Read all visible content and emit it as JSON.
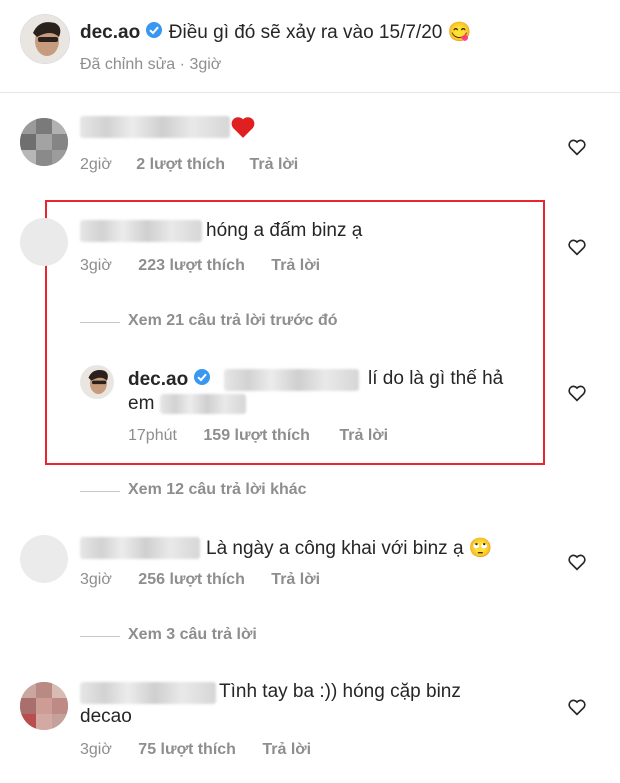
{
  "post": {
    "username": "dec.ao",
    "caption": "Điều gì đó sẽ xảy ra vào 15/7/20",
    "emoji": "😋",
    "edited": "Đã chỉnh sửa",
    "separator": "·",
    "time": "3giờ"
  },
  "comments": [
    {
      "text": "❤️",
      "time": "2giờ",
      "likes": "2 lượt thích",
      "reply": "Trả lời"
    },
    {
      "text": "hóng a đấm binz ạ",
      "time": "3giờ",
      "likes": "223 lượt thích",
      "reply": "Trả lời"
    },
    {
      "text": "Là ngày a công khai với binz ạ",
      "emoji": "🙄",
      "time": "3giờ",
      "likes": "256 lượt thích",
      "reply": "Trả lời"
    },
    {
      "text_line1": "Tình tay ba :)) hóng cặp binz",
      "text_line2": "decao",
      "time": "3giờ",
      "likes": "75 lượt thích",
      "reply": "Trả lời"
    }
  ],
  "reply": {
    "username": "dec.ao",
    "text_line1": "lí do là gì thế hả",
    "text_line2": "em",
    "time": "17phút",
    "likes": "159 lượt thích",
    "reply_label": "Trả lời"
  },
  "view_replies": {
    "previous": "Xem 21 câu trả lời trước đó",
    "other": "Xem 12 câu trả lời khác",
    "three": "Xem 3 câu trả lời"
  },
  "colors": {
    "highlight_border": "#e8262f",
    "verified": "#3897f0",
    "heart_red": "#ed4956",
    "meta_gray": "#8e8e8e"
  },
  "icons": [
    "verified-badge-icon",
    "like-heart-icon",
    "red-heart-emoji"
  ]
}
